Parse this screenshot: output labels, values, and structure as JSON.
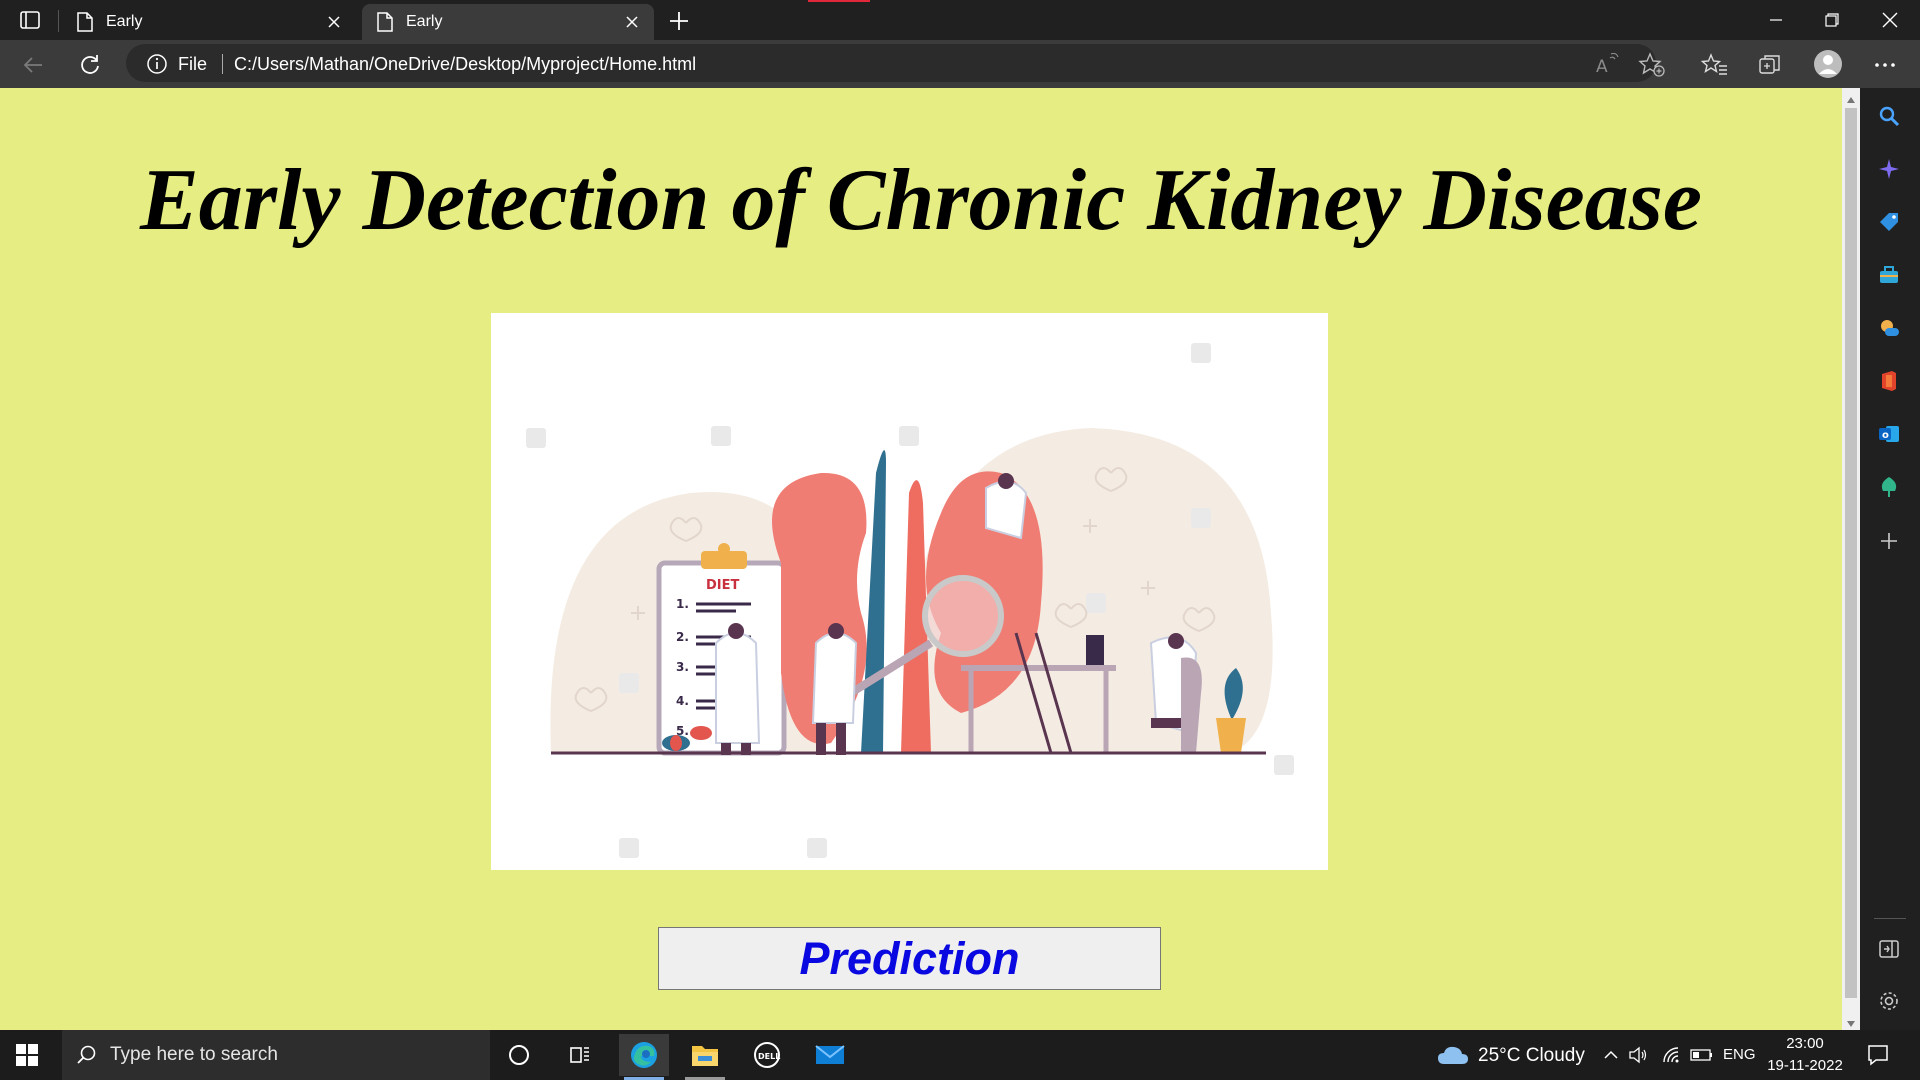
{
  "browser": {
    "tabs": [
      {
        "title": "Early",
        "active": false
      },
      {
        "title": "Early",
        "active": true
      }
    ],
    "address": {
      "scheme_label": "File",
      "url": "C:/Users/Mathan/OneDrive/Desktop/Myproject/Home.html"
    }
  },
  "page": {
    "background_color": "#e6ed82",
    "title": "Early Detection of Chronic Kidney Disease",
    "hero_image": {
      "description_icon": "kidney-illustration",
      "clipboard_heading": "DIET",
      "list_numbers": [
        "1.",
        "2.",
        "3.",
        "4.",
        "5."
      ]
    },
    "prediction_button": "Prediction",
    "button_text_color": "#0a08e0"
  },
  "sidebar": {
    "icons": [
      "search-icon",
      "sparkle-icon",
      "tag-icon",
      "toolbox-icon",
      "games-icon",
      "office-icon",
      "outlook-icon",
      "tree-icon",
      "add-icon",
      "split-screen-icon",
      "settings-icon"
    ]
  },
  "taskbar": {
    "search_placeholder": "Type here to search",
    "weather": "25°C  Cloudy",
    "language": "ENG",
    "time": "23:00",
    "date": "19-11-2022"
  }
}
